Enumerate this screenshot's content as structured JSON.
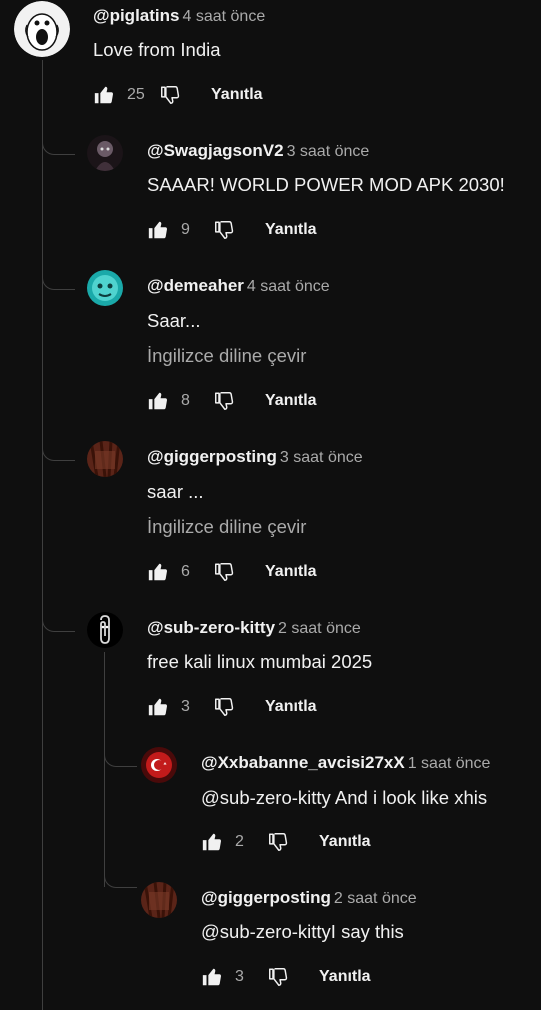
{
  "colors": {
    "background": "#0f0f0f",
    "text": "#f1f1f1",
    "muted": "#aaaaaa",
    "line": "#3f3f3f"
  },
  "icons": {
    "like": "thumbs-up-icon",
    "dislike": "thumbs-down-icon"
  },
  "comments": [
    {
      "author": "@piglatins",
      "time": "4 saat önce",
      "text": "Love from India",
      "translate": "",
      "likes": "25",
      "reply": "Yanıtla"
    },
    {
      "author": "@SwagjagsonV2",
      "time": "3 saat önce",
      "text": "SAAAR! WORLD POWER MOD APK 2030!",
      "translate": "",
      "likes": "9",
      "reply": "Yanıtla"
    },
    {
      "author": "@demeaher",
      "time": "4 saat önce",
      "text": "Saar...",
      "translate": "İngilizce diline çevir",
      "likes": "8",
      "reply": "Yanıtla"
    },
    {
      "author": "@giggerposting",
      "time": "3 saat önce",
      "text": "saar ...",
      "translate": "İngilizce diline çevir",
      "likes": "6",
      "reply": "Yanıtla"
    },
    {
      "author": "@sub-zero-kitty",
      "time": "2 saat önce",
      "text": "free kali linux mumbai 2025",
      "translate": "",
      "likes": "3",
      "reply": "Yanıtla"
    },
    {
      "author": "@Xxbabanne_avcisi27xX",
      "time": "1 saat önce",
      "text": "@sub-zero-kitty And i look like xhis",
      "translate": "",
      "likes": "2",
      "reply": "Yanıtla"
    },
    {
      "author": "@giggerposting",
      "time": "2 saat önce",
      "text": "@sub-zero-kittyI say this",
      "translate": "",
      "likes": "3",
      "reply": "Yanıtla"
    }
  ]
}
